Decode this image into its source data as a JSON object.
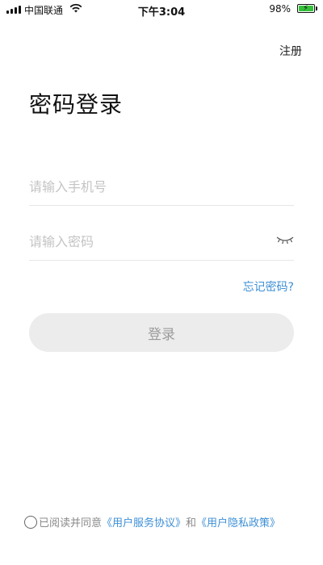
{
  "status_bar": {
    "carrier": "中国联通",
    "time": "下午3:04",
    "battery_percent": "98%",
    "battery_level": 0.98,
    "icons": {
      "signal": "signal-icon",
      "wifi": "wifi-icon",
      "battery": "battery-charging-icon"
    }
  },
  "header": {
    "register_label": "注册"
  },
  "main": {
    "title": "密码登录",
    "phone_placeholder": "请输入手机号",
    "password_placeholder": "请输入密码",
    "password_visibility_icon": "eye-closed-icon",
    "forgot_label": "忘记密码?",
    "login_label": "登录"
  },
  "agreement": {
    "prefix": "已阅读并同意",
    "user_agreement": "《用户服务协议》",
    "conjunction": "和",
    "privacy_policy": "《用户隐私政策》"
  },
  "colors": {
    "accent": "#3d8fd6",
    "button_bg": "#ececec",
    "button_text": "#9b9b9b",
    "placeholder": "#c4c4c4",
    "battery": "#35c13a"
  }
}
